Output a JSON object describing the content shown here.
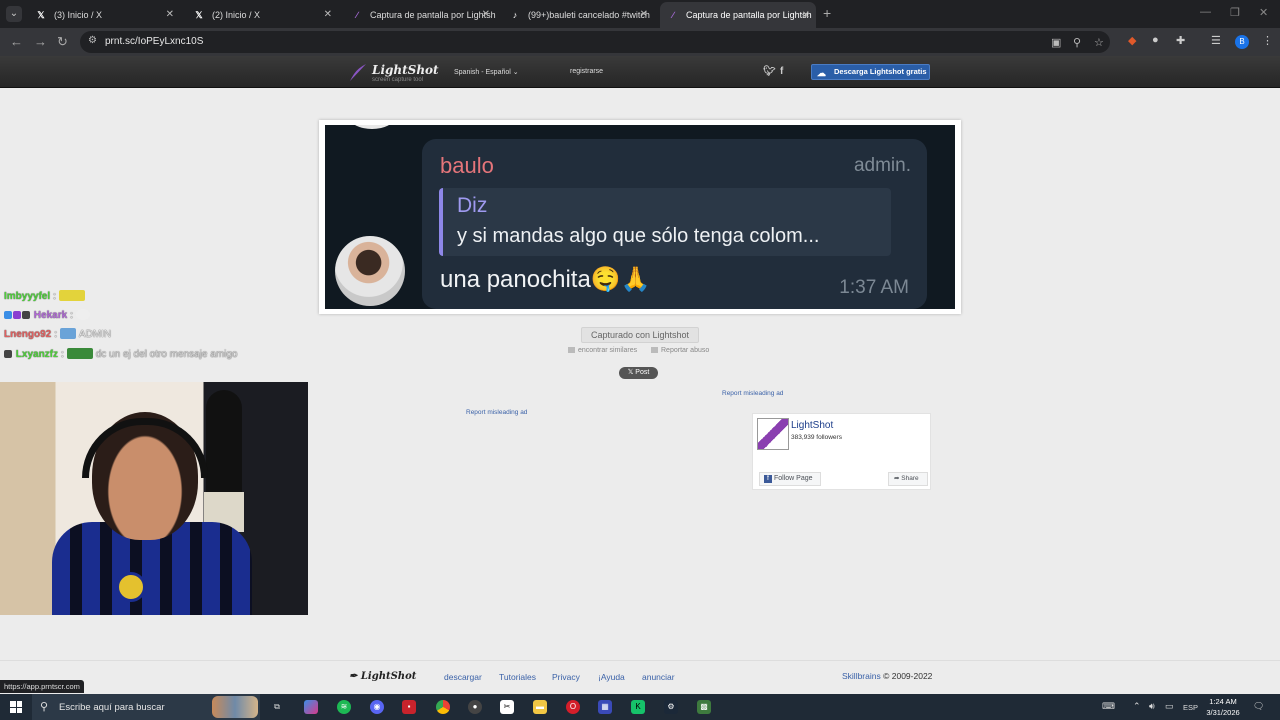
{
  "browser": {
    "tabs": [
      {
        "title": "(3) Inicio / X",
        "icon": "x-logo-icon"
      },
      {
        "title": "(2) Inicio / X",
        "icon": "x-logo-icon"
      },
      {
        "title": "Captura de pantalla por Lightsh",
        "icon": "lightshot-feather-icon"
      },
      {
        "title": "(99+)bauleti cancelado #twitch",
        "icon": "tiktok-icon"
      },
      {
        "title": "Captura de pantalla por Lightsh",
        "icon": "lightshot-feather-icon",
        "active": true
      }
    ],
    "url": "prnt.sc/IoPEyLxnc10S",
    "profile_initial": "B",
    "status_url": "https://app.prntscr.com"
  },
  "header": {
    "logo": "LightShot",
    "tagline": "screen capture tool",
    "language": "Spanish - Español",
    "register": "registrarse",
    "download": "Descarga Lightshot gratis"
  },
  "message": {
    "sender": "baulo",
    "role": "admin.",
    "reply_name": "Diz",
    "reply_text": "y si mandas algo que sólo tenga colom...",
    "text": "una panochita🤤🙏",
    "time": "1:37 AM"
  },
  "actions": {
    "captured": "Capturado con Lightshot",
    "similar": "encontrar similares",
    "report_abuse": "Reportar abuso",
    "post": "Post",
    "report_ad": "Report misleading ad"
  },
  "facebook": {
    "page_name": "LightShot",
    "followers": "383,939 followers",
    "follow": "Follow Page",
    "share": "Share"
  },
  "chat": [
    {
      "user": "Imbyyyfel",
      "sep": ":",
      "color": "#4fd13b",
      "text": ""
    },
    {
      "user": "Hekark",
      "sep": ":",
      "color": "#b06ad6",
      "text": ""
    },
    {
      "user": "Lnengo92",
      "sep": ":",
      "color": "#e06060",
      "text": "ADMIN"
    },
    {
      "user": "Lxyanzfz",
      "sep": ":",
      "color": "#4fd13b",
      "text": "dc un ej del otro mensaje amigo"
    }
  ],
  "footer": {
    "logo": "LightShot",
    "links": [
      "descargar",
      "Tutoriales",
      "Privacy",
      "¡Ayuda",
      "anunciar"
    ],
    "brand": "Skillbrains",
    "copyright": "© 2009-2022"
  },
  "taskbar": {
    "search_placeholder": "Escribe aquí para buscar",
    "language": "ESP",
    "time": "1:24 AM",
    "date": "3/31/2026"
  },
  "colors": {
    "lightshot_dark": "#262626",
    "download_blue": "#2a5ea8",
    "telegram_bubble": "#212d3b",
    "link_blue": "#3b62a8"
  }
}
